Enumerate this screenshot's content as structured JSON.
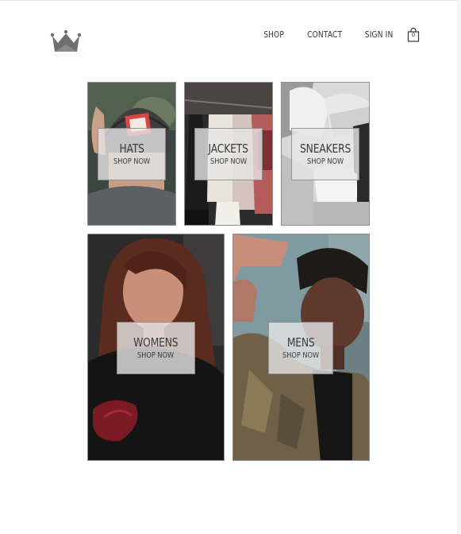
{
  "header": {
    "logo": "crown-logo",
    "nav": [
      {
        "label": "SHOP"
      },
      {
        "label": "CONTACT"
      },
      {
        "label": "SIGN IN"
      }
    ],
    "cart_count": "0",
    "cart_icon": "shopping-bag-icon"
  },
  "categories": [
    {
      "title": "HATS",
      "subtitle": "SHOP NOW"
    },
    {
      "title": "JACKETS",
      "subtitle": "SHOP NOW"
    },
    {
      "title": "SNEAKERS",
      "subtitle": "SHOP NOW"
    },
    {
      "title": "WOMENS",
      "subtitle": "SHOP NOW"
    },
    {
      "title": "MENS",
      "subtitle": "SHOP NOW"
    }
  ],
  "colors": {
    "logo": "#6f6f6f",
    "label_bg": "#e6e6e6",
    "text": "#333333"
  }
}
